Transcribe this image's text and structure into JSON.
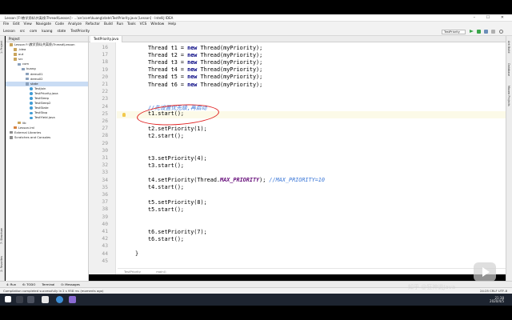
{
  "window": {
    "title": "Lesson [F:\\教学资料\\共离线\\Thread\\Lesson] - ...\\src\\com\\kuang\\state\\TestPriority.java [Lesson] - IntelliJ IDEA"
  },
  "menu": [
    "File",
    "Edit",
    "View",
    "Navigate",
    "Code",
    "Analyze",
    "Refactor",
    "Build",
    "Run",
    "Tools",
    "VCS",
    "Window",
    "Help"
  ],
  "breadcrumbs": [
    "Lesson",
    "src",
    "com",
    "kuang",
    "state",
    "TestPriority"
  ],
  "run_config": "TestPriority",
  "left_strip": [
    "1: Project",
    "7: Structure",
    "2: Favorites"
  ],
  "right_strip": [
    "Ant Build",
    "Database",
    "Maven Projects"
  ],
  "project": {
    "header": "Project",
    "tree": [
      {
        "label": "Lesson  F:\\教学资料\\共离线\\Thread\\Lesson",
        "icon": "folder",
        "indent": 1
      },
      {
        "label": ".idea",
        "icon": "folder",
        "indent": 2
      },
      {
        "label": "out",
        "icon": "folder",
        "indent": 2
      },
      {
        "label": "src",
        "icon": "folder",
        "indent": 2
      },
      {
        "label": "com",
        "icon": "pkg",
        "indent": 3
      },
      {
        "label": "kuang",
        "icon": "pkg",
        "indent": 4
      },
      {
        "label": "demo01",
        "icon": "pkg",
        "indent": 5
      },
      {
        "label": "demo02",
        "icon": "pkg",
        "indent": 5
      },
      {
        "label": "state",
        "icon": "pkg",
        "indent": 5,
        "selected": true
      },
      {
        "label": "TestJoin",
        "icon": "java",
        "indent": 6
      },
      {
        "label": "TestPriority.java",
        "icon": "java",
        "indent": 6
      },
      {
        "label": "TestSleep",
        "icon": "java",
        "indent": 6
      },
      {
        "label": "TestSleep2",
        "icon": "java",
        "indent": 6
      },
      {
        "label": "TestState",
        "icon": "java",
        "indent": 6
      },
      {
        "label": "TestStop",
        "icon": "java",
        "indent": 6
      },
      {
        "label": "TestYield.java",
        "icon": "java",
        "indent": 6
      },
      {
        "label": "lib",
        "icon": "folder",
        "indent": 3
      },
      {
        "label": "Lesson.iml",
        "icon": "xml",
        "indent": 2
      },
      {
        "label": "External Libraries",
        "icon": "lib",
        "indent": 1
      },
      {
        "label": "Scratches and Consoles",
        "icon": "lib",
        "indent": 1
      }
    ]
  },
  "editor": {
    "tab": "TestPriority.java",
    "lines": [
      {
        "n": "16",
        "segs": [
          [
            "Thread t1 = ",
            ""
          ],
          [
            "new",
            "kw"
          ],
          [
            " Thread(myPriority);",
            ""
          ]
        ]
      },
      {
        "n": "17",
        "segs": [
          [
            "Thread t2 = ",
            ""
          ],
          [
            "new",
            "kw"
          ],
          [
            " Thread(myPriority);",
            ""
          ]
        ]
      },
      {
        "n": "18",
        "segs": [
          [
            "Thread t3 = ",
            ""
          ],
          [
            "new",
            "kw"
          ],
          [
            " Thread(myPriority);",
            ""
          ]
        ]
      },
      {
        "n": "19",
        "segs": [
          [
            "Thread t4 = ",
            ""
          ],
          [
            "new",
            "kw"
          ],
          [
            " Thread(myPriority);",
            ""
          ]
        ]
      },
      {
        "n": "20",
        "segs": [
          [
            "Thread t5 = ",
            ""
          ],
          [
            "new",
            "kw"
          ],
          [
            " Thread(myPriority);",
            ""
          ]
        ]
      },
      {
        "n": "21",
        "segs": [
          [
            "Thread t6 = ",
            ""
          ],
          [
            "new",
            "kw"
          ],
          [
            " Thread(myPriority);",
            ""
          ]
        ]
      },
      {
        "n": "22",
        "segs": []
      },
      {
        "n": "23",
        "segs": []
      },
      {
        "n": "24",
        "segs": [
          [
            "//先设置优先级,再启动",
            "cm-blue"
          ]
        ]
      },
      {
        "n": "25",
        "segs": [
          [
            "t1.start();",
            ""
          ]
        ]
      },
      {
        "n": "26",
        "segs": []
      },
      {
        "n": "27",
        "segs": [
          [
            "t2.setPriority(1);",
            ""
          ]
        ]
      },
      {
        "n": "28",
        "segs": [
          [
            "t2.start();",
            ""
          ]
        ]
      },
      {
        "n": "29",
        "segs": []
      },
      {
        "n": "30",
        "segs": []
      },
      {
        "n": "31",
        "segs": [
          [
            "t3.setPriority(4);",
            ""
          ]
        ]
      },
      {
        "n": "32",
        "segs": [
          [
            "t3.start();",
            ""
          ]
        ]
      },
      {
        "n": "33",
        "segs": []
      },
      {
        "n": "34",
        "segs": [
          [
            "t4.setPriority(Thread.",
            ""
          ],
          [
            "MAX_PRIORITY",
            "const"
          ],
          [
            "); ",
            ""
          ],
          [
            "//MAX_PRIORITY=10",
            "cm-blue"
          ]
        ]
      },
      {
        "n": "35",
        "segs": [
          [
            "t4.start();",
            ""
          ]
        ]
      },
      {
        "n": "36",
        "segs": []
      },
      {
        "n": "37",
        "segs": [
          [
            "t5.setPriority(8);",
            ""
          ]
        ]
      },
      {
        "n": "38",
        "segs": [
          [
            "t5.start();",
            ""
          ]
        ]
      },
      {
        "n": "39",
        "segs": []
      },
      {
        "n": "40",
        "segs": []
      },
      {
        "n": "41",
        "segs": [
          [
            "t6.setPriority(7);",
            ""
          ]
        ]
      },
      {
        "n": "42",
        "segs": [
          [
            "t6.start();",
            ""
          ]
        ]
      },
      {
        "n": "43",
        "segs": []
      },
      {
        "n": "44",
        "segs": [
          [
            "}",
            ""
          ]
        ]
      },
      {
        "n": "45",
        "segs": []
      }
    ],
    "hint": [
      "TestPriority",
      "main()"
    ]
  },
  "bottom_tools": [
    "4: Run",
    "6: TODO",
    "Terminal",
    "0: Messages"
  ],
  "status": {
    "message": "Compilation completed successfully in 2 s 958 ms (moments ago)",
    "position": "24:25  CRLF  UTF-8"
  },
  "watermark": "知乎 @狂神说Java",
  "tray": {
    "time": "21:38",
    "date": "2020/4/5"
  }
}
